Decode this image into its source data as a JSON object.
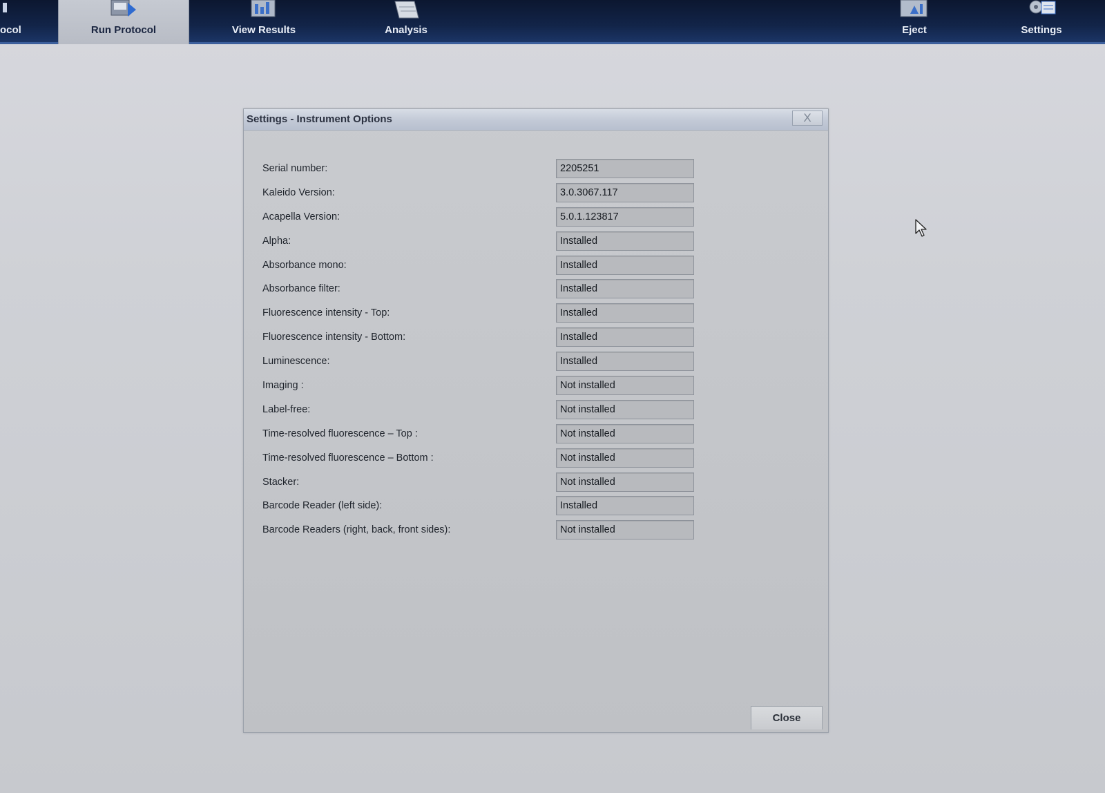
{
  "toolbar": {
    "items": [
      {
        "label": "ocol",
        "icon": "protocol-icon"
      },
      {
        "label": "Run Protocol",
        "icon": "run-protocol-icon",
        "active": true
      },
      {
        "label": "View Results",
        "icon": "view-results-icon"
      },
      {
        "label": "Analysis",
        "icon": "analysis-icon"
      },
      {
        "label": "Eject",
        "icon": "eject-icon"
      },
      {
        "label": "Settings",
        "icon": "settings-icon"
      }
    ]
  },
  "dialog": {
    "title": "Settings - Instrument Options",
    "close_x": "X",
    "close_label": "Close",
    "rows": [
      {
        "label": "Serial number:",
        "value": "2205251"
      },
      {
        "label": "Kaleido Version:",
        "value": "3.0.3067.117"
      },
      {
        "label": "Acapella Version:",
        "value": "5.0.1.123817"
      },
      {
        "label": "Alpha:",
        "value": "Installed"
      },
      {
        "label": "Absorbance mono:",
        "value": "Installed"
      },
      {
        "label": "Absorbance filter:",
        "value": "Installed"
      },
      {
        "label": "Fluorescence intensity - Top:",
        "value": "Installed"
      },
      {
        "label": "Fluorescence intensity - Bottom:",
        "value": "Installed"
      },
      {
        "label": "Luminescence:",
        "value": "Installed"
      },
      {
        "label": "Imaging :",
        "value": "Not installed"
      },
      {
        "label": "Label-free:",
        "value": "Not installed"
      },
      {
        "label": "Time-resolved fluorescence – Top :",
        "value": "Not installed"
      },
      {
        "label": "Time-resolved fluorescence – Bottom :",
        "value": "Not installed"
      },
      {
        "label": "Stacker:",
        "value": "Not installed"
      },
      {
        "label": "Barcode Reader (left side):",
        "value": "Installed"
      },
      {
        "label": "Barcode Readers (right, back, front sides):",
        "value": "Not installed"
      }
    ]
  },
  "colors": {
    "toolbar_bg": "#122448",
    "dialog_bg": "#c4c6ca",
    "field_bg": "#b8babe"
  }
}
